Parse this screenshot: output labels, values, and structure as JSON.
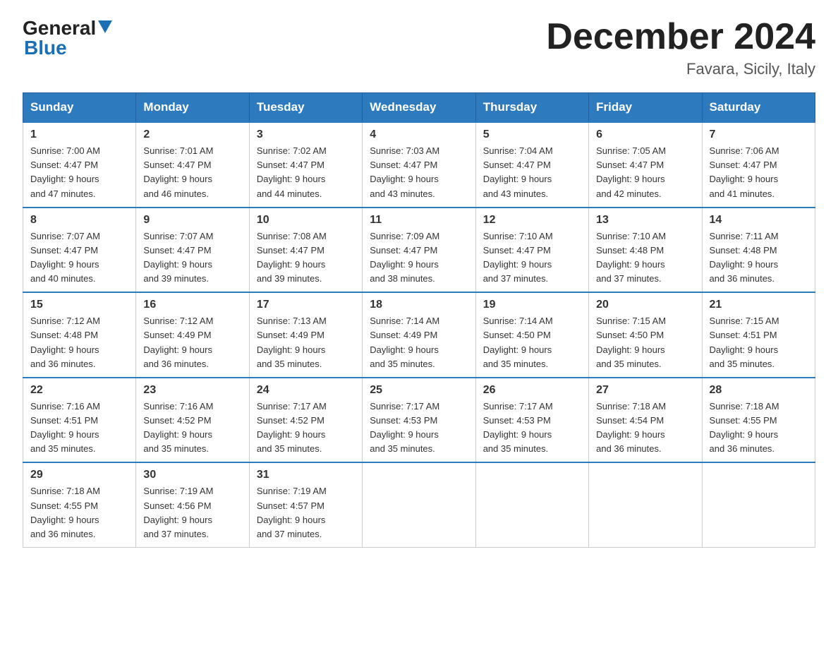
{
  "logo": {
    "general": "General",
    "blue": "Blue"
  },
  "header": {
    "title": "December 2024",
    "subtitle": "Favara, Sicily, Italy"
  },
  "days_of_week": [
    "Sunday",
    "Monday",
    "Tuesday",
    "Wednesday",
    "Thursday",
    "Friday",
    "Saturday"
  ],
  "weeks": [
    [
      {
        "day": "1",
        "sunrise": "7:00 AM",
        "sunset": "4:47 PM",
        "daylight": "9 hours and 47 minutes."
      },
      {
        "day": "2",
        "sunrise": "7:01 AM",
        "sunset": "4:47 PM",
        "daylight": "9 hours and 46 minutes."
      },
      {
        "day": "3",
        "sunrise": "7:02 AM",
        "sunset": "4:47 PM",
        "daylight": "9 hours and 44 minutes."
      },
      {
        "day": "4",
        "sunrise": "7:03 AM",
        "sunset": "4:47 PM",
        "daylight": "9 hours and 43 minutes."
      },
      {
        "day": "5",
        "sunrise": "7:04 AM",
        "sunset": "4:47 PM",
        "daylight": "9 hours and 43 minutes."
      },
      {
        "day": "6",
        "sunrise": "7:05 AM",
        "sunset": "4:47 PM",
        "daylight": "9 hours and 42 minutes."
      },
      {
        "day": "7",
        "sunrise": "7:06 AM",
        "sunset": "4:47 PM",
        "daylight": "9 hours and 41 minutes."
      }
    ],
    [
      {
        "day": "8",
        "sunrise": "7:07 AM",
        "sunset": "4:47 PM",
        "daylight": "9 hours and 40 minutes."
      },
      {
        "day": "9",
        "sunrise": "7:07 AM",
        "sunset": "4:47 PM",
        "daylight": "9 hours and 39 minutes."
      },
      {
        "day": "10",
        "sunrise": "7:08 AM",
        "sunset": "4:47 PM",
        "daylight": "9 hours and 39 minutes."
      },
      {
        "day": "11",
        "sunrise": "7:09 AM",
        "sunset": "4:47 PM",
        "daylight": "9 hours and 38 minutes."
      },
      {
        "day": "12",
        "sunrise": "7:10 AM",
        "sunset": "4:47 PM",
        "daylight": "9 hours and 37 minutes."
      },
      {
        "day": "13",
        "sunrise": "7:10 AM",
        "sunset": "4:48 PM",
        "daylight": "9 hours and 37 minutes."
      },
      {
        "day": "14",
        "sunrise": "7:11 AM",
        "sunset": "4:48 PM",
        "daylight": "9 hours and 36 minutes."
      }
    ],
    [
      {
        "day": "15",
        "sunrise": "7:12 AM",
        "sunset": "4:48 PM",
        "daylight": "9 hours and 36 minutes."
      },
      {
        "day": "16",
        "sunrise": "7:12 AM",
        "sunset": "4:49 PM",
        "daylight": "9 hours and 36 minutes."
      },
      {
        "day": "17",
        "sunrise": "7:13 AM",
        "sunset": "4:49 PM",
        "daylight": "9 hours and 35 minutes."
      },
      {
        "day": "18",
        "sunrise": "7:14 AM",
        "sunset": "4:49 PM",
        "daylight": "9 hours and 35 minutes."
      },
      {
        "day": "19",
        "sunrise": "7:14 AM",
        "sunset": "4:50 PM",
        "daylight": "9 hours and 35 minutes."
      },
      {
        "day": "20",
        "sunrise": "7:15 AM",
        "sunset": "4:50 PM",
        "daylight": "9 hours and 35 minutes."
      },
      {
        "day": "21",
        "sunrise": "7:15 AM",
        "sunset": "4:51 PM",
        "daylight": "9 hours and 35 minutes."
      }
    ],
    [
      {
        "day": "22",
        "sunrise": "7:16 AM",
        "sunset": "4:51 PM",
        "daylight": "9 hours and 35 minutes."
      },
      {
        "day": "23",
        "sunrise": "7:16 AM",
        "sunset": "4:52 PM",
        "daylight": "9 hours and 35 minutes."
      },
      {
        "day": "24",
        "sunrise": "7:17 AM",
        "sunset": "4:52 PM",
        "daylight": "9 hours and 35 minutes."
      },
      {
        "day": "25",
        "sunrise": "7:17 AM",
        "sunset": "4:53 PM",
        "daylight": "9 hours and 35 minutes."
      },
      {
        "day": "26",
        "sunrise": "7:17 AM",
        "sunset": "4:53 PM",
        "daylight": "9 hours and 35 minutes."
      },
      {
        "day": "27",
        "sunrise": "7:18 AM",
        "sunset": "4:54 PM",
        "daylight": "9 hours and 36 minutes."
      },
      {
        "day": "28",
        "sunrise": "7:18 AM",
        "sunset": "4:55 PM",
        "daylight": "9 hours and 36 minutes."
      }
    ],
    [
      {
        "day": "29",
        "sunrise": "7:18 AM",
        "sunset": "4:55 PM",
        "daylight": "9 hours and 36 minutes."
      },
      {
        "day": "30",
        "sunrise": "7:19 AM",
        "sunset": "4:56 PM",
        "daylight": "9 hours and 37 minutes."
      },
      {
        "day": "31",
        "sunrise": "7:19 AM",
        "sunset": "4:57 PM",
        "daylight": "9 hours and 37 minutes."
      },
      null,
      null,
      null,
      null
    ]
  ],
  "labels": {
    "sunrise": "Sunrise:",
    "sunset": "Sunset:",
    "daylight": "Daylight:"
  }
}
